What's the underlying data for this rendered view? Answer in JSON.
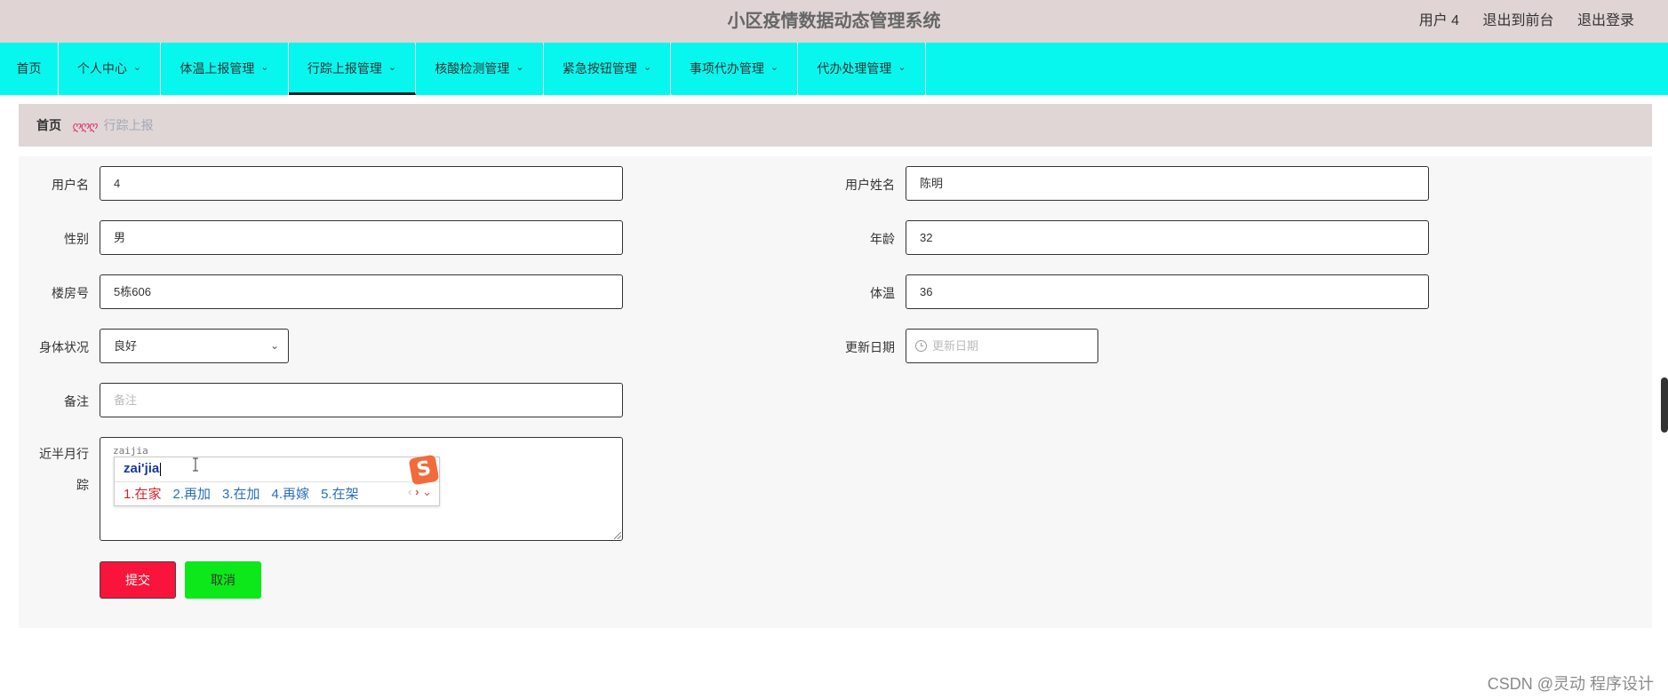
{
  "header": {
    "title": "小区疫情数据动态管理系统",
    "user": "用户 4",
    "to_front": "退出到前台",
    "logout": "退出登录"
  },
  "nav": {
    "items": [
      {
        "label": "首页",
        "dropdown": false
      },
      {
        "label": "个人中心",
        "dropdown": true
      },
      {
        "label": "体温上报管理",
        "dropdown": true
      },
      {
        "label": "行踪上报管理",
        "dropdown": true,
        "active": true
      },
      {
        "label": "核酸检测管理",
        "dropdown": true
      },
      {
        "label": "紧急按钮管理",
        "dropdown": true
      },
      {
        "label": "事项代办管理",
        "dropdown": true
      },
      {
        "label": "代办处理管理",
        "dropdown": true
      }
    ],
    "chevron": "⌄"
  },
  "breadcrumb": {
    "home": "首页",
    "separator": "ღღღ",
    "current": "行踪上报"
  },
  "form": {
    "username": {
      "label": "用户名",
      "value": "4"
    },
    "fullname": {
      "label": "用户姓名",
      "value": "陈明"
    },
    "gender": {
      "label": "性别",
      "value": "男"
    },
    "age": {
      "label": "年龄",
      "value": "32"
    },
    "room": {
      "label": "楼房号",
      "value": "5栋606"
    },
    "temperature": {
      "label": "体温",
      "value": "36"
    },
    "health": {
      "label": "身体状况",
      "value": "良好"
    },
    "update_date": {
      "label": "更新日期",
      "placeholder": "更新日期"
    },
    "remark": {
      "label": "备注",
      "placeholder": "备注"
    },
    "trace": {
      "label_line1": "近半月行",
      "label_line2": "踪",
      "typed": "zaijia"
    }
  },
  "ime": {
    "pinyin": "zai'jia",
    "candidates": [
      "1.在家",
      "2.再加",
      "3.在加",
      "4.再嫁",
      "5.在架"
    ],
    "prev": "‹",
    "next": "›",
    "expand": "⌄",
    "logo": "S"
  },
  "buttons": {
    "submit": "提交",
    "cancel": "取消"
  },
  "watermark": "CSDN @灵动 程序设计",
  "colors": {
    "header_bg": "#e0d4d4",
    "nav_bg": "#07f7ee",
    "submit_bg": "#f8143a",
    "cancel_bg": "#0de81a"
  }
}
